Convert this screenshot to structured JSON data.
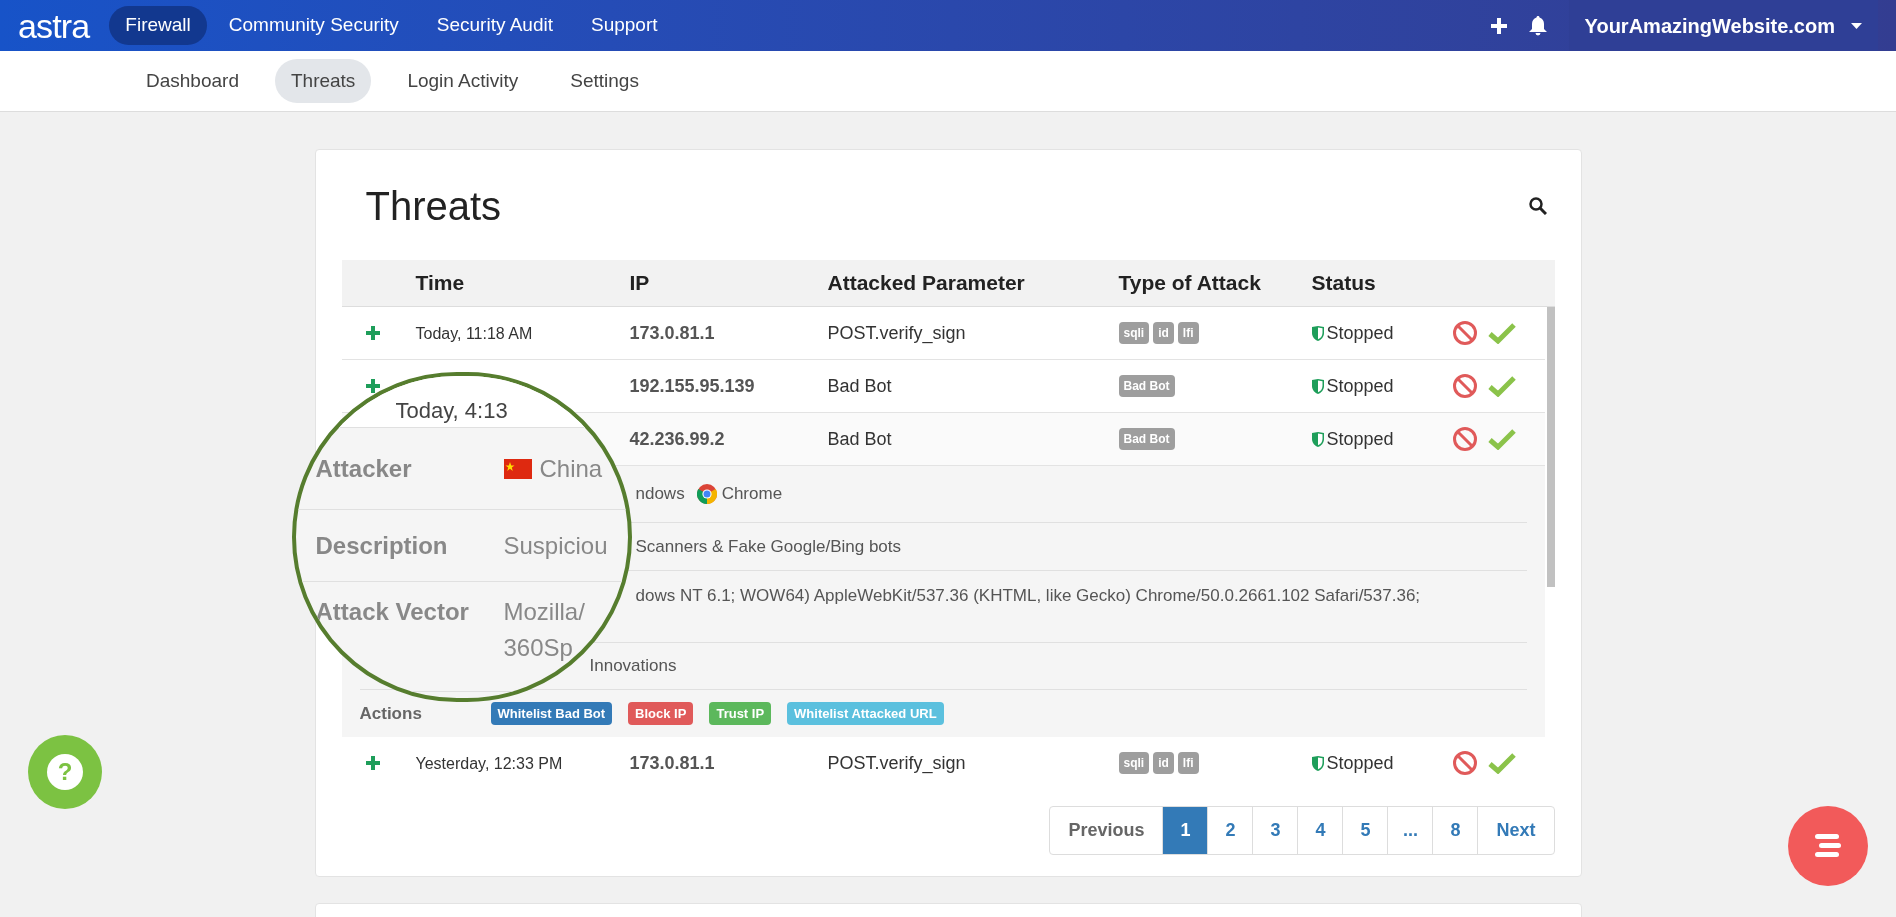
{
  "brand": {
    "logo": "astra"
  },
  "top_nav": [
    {
      "label": "Firewall",
      "selected": true
    },
    {
      "label": "Community Security",
      "selected": false
    },
    {
      "label": "Security Audit",
      "selected": false
    },
    {
      "label": "Support",
      "selected": false
    }
  ],
  "site_menu": {
    "label": "YourAmazingWebsite.com"
  },
  "sub_nav": [
    {
      "label": "Dashboard",
      "selected": false
    },
    {
      "label": "Threats",
      "selected": true
    },
    {
      "label": "Login Activity",
      "selected": false
    },
    {
      "label": "Settings",
      "selected": false
    }
  ],
  "threats": {
    "title": "Threats",
    "columns": [
      "Time",
      "IP",
      "Attacked Parameter",
      "Type of Attack",
      "Status"
    ],
    "rows": [
      {
        "time": "Today, 11:18 AM",
        "ip": "173.0.81.1",
        "parameter": "POST.verify_sign",
        "tags": [
          "sqli",
          "id",
          "lfi"
        ],
        "status": "Stopped",
        "expanded": false
      },
      {
        "ip": "192.155.95.139",
        "parameter": "Bad Bot",
        "tags": [
          "Bad Bot"
        ],
        "status": "Stopped",
        "expanded": false
      },
      {
        "ip": "42.236.99.2",
        "parameter": "Bad Bot",
        "tags": [
          "Bad Bot"
        ],
        "status": "Stopped",
        "expanded": true
      },
      {
        "time": "Yesterday, 12:33 PM",
        "ip": "173.0.81.1",
        "parameter": "POST.verify_sign",
        "tags": [
          "sqli",
          "id",
          "lfi"
        ],
        "status": "Stopped",
        "expanded": false
      }
    ],
    "details": {
      "platform": "ndows",
      "browser": "Chrome",
      "description": "Scanners & Fake Google/Bing bots",
      "vector": "dows NT 6.1; WOW64) AppleWebKit/537.36 (KHTML, like Gecko) Chrome/50.0.2661.102 Safari/537.36;",
      "vector_line_2": "Innovations",
      "actions_label": "Actions",
      "actions": [
        {
          "label": "Whitelist Bad Bot",
          "color": "#337ab7"
        },
        {
          "label": "Block IP",
          "color": "#e05a5a"
        },
        {
          "label": "Trust IP",
          "color": "#5cb85c"
        },
        {
          "label": "Whitelist Attacked URL",
          "color": "#5bc0de"
        }
      ]
    }
  },
  "magnifier": {
    "time": "Today, 4:13",
    "rows": [
      {
        "label": "Attacker",
        "value": "China",
        "kind": "flag"
      },
      {
        "label": "Description",
        "value": "Suspiciou",
        "kind": "text"
      },
      {
        "label": "Attack Vector",
        "value": "Mozilla/",
        "value_line_2": "360Sp",
        "kind": "text"
      }
    ]
  },
  "pagination": {
    "previous": "Previous",
    "pages": [
      {
        "label": "1",
        "selected": true
      },
      {
        "label": "2",
        "selected": false
      },
      {
        "label": "3",
        "selected": false
      },
      {
        "label": "4",
        "selected": false
      },
      {
        "label": "5",
        "selected": false
      },
      {
        "label": "...",
        "selected": false
      },
      {
        "label": "8",
        "selected": false
      }
    ],
    "next": "Next"
  },
  "help": {
    "label": "?"
  }
}
